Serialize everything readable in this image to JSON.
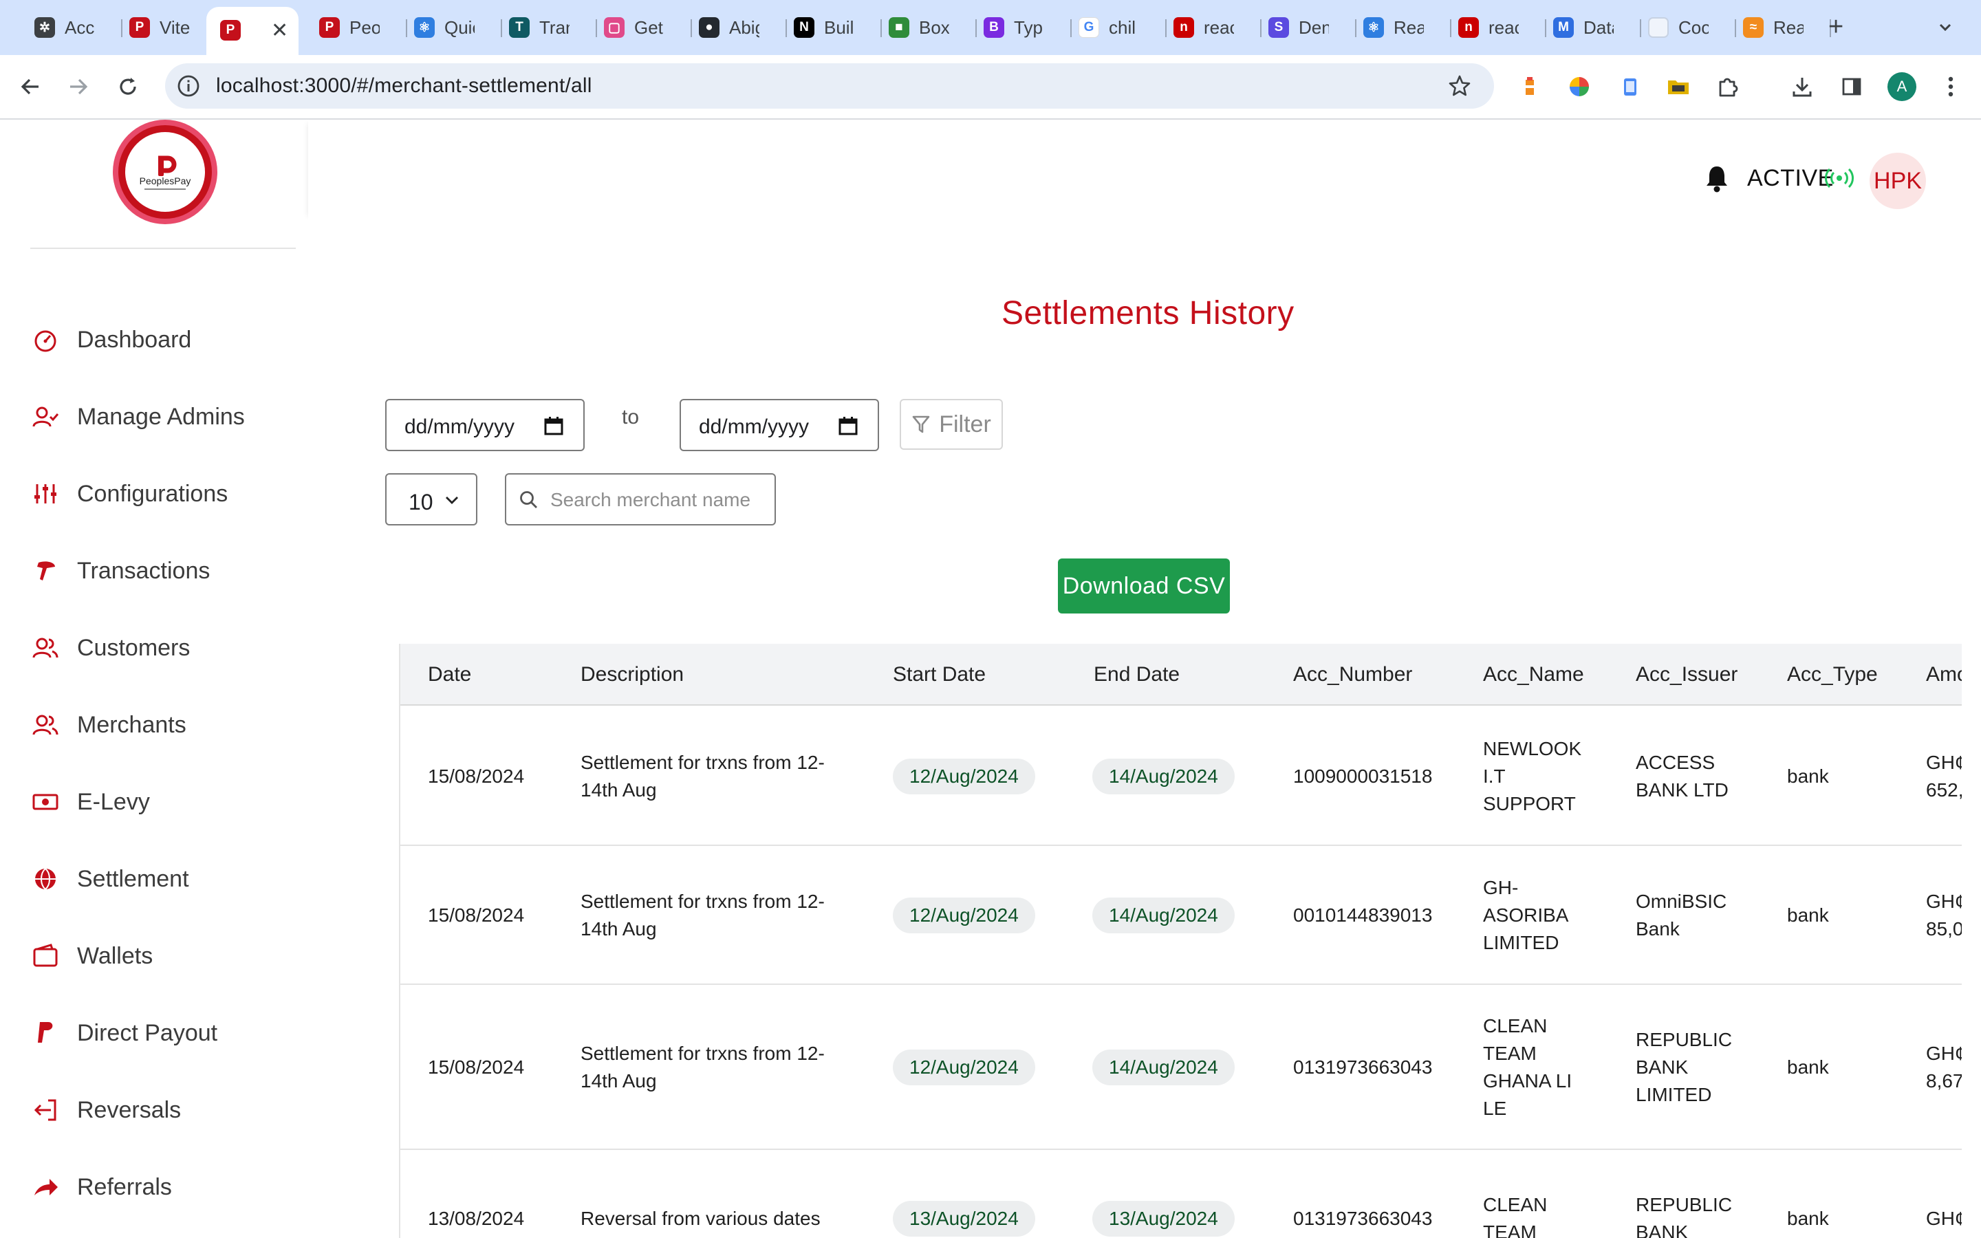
{
  "browser": {
    "tabs": [
      {
        "title": "Acc",
        "favicon": "openai-icon"
      },
      {
        "title": "Vite",
        "favicon": "peoplespay-icon"
      },
      {
        "title": "",
        "favicon": "peoplespay-icon",
        "active": true
      },
      {
        "title": "Peo",
        "favicon": "peoplespay-icon"
      },
      {
        "title": "Quic",
        "favicon": "react-icon"
      },
      {
        "title": "Tran",
        "favicon": "translate-icon"
      },
      {
        "title": "Get",
        "favicon": "app-icon"
      },
      {
        "title": "Abig",
        "favicon": "github-icon"
      },
      {
        "title": "Buil",
        "favicon": "nextjs-icon"
      },
      {
        "title": "Box",
        "favicon": "box-icon"
      },
      {
        "title": "Typ",
        "favicon": "bootstrap-icon"
      },
      {
        "title": "chil",
        "favicon": "google-icon"
      },
      {
        "title": "reac",
        "favicon": "npm-icon"
      },
      {
        "title": "Den",
        "favicon": "stitches-icon"
      },
      {
        "title": "Rea",
        "favicon": "react-icon"
      },
      {
        "title": "reac",
        "favicon": "npm-icon"
      },
      {
        "title": "Data",
        "favicon": "mui-icon"
      },
      {
        "title": "Coo",
        "favicon": "blank-page-icon"
      },
      {
        "title": "Rea",
        "favicon": "rainbow-icon"
      }
    ],
    "url": "localhost:3000/#/merchant-settlement/all",
    "profile_initial": "A"
  },
  "sidebar": {
    "logo_text": "PeoplesPay",
    "items": [
      {
        "label": "Dashboard",
        "icon": "dashboard-gauge-icon"
      },
      {
        "label": "Manage Admins",
        "icon": "user-check-icon"
      },
      {
        "label": "Configurations",
        "icon": "sliders-icon"
      },
      {
        "label": "Transactions",
        "icon": "transactions-icon"
      },
      {
        "label": "Customers",
        "icon": "users-icon"
      },
      {
        "label": "Merchants",
        "icon": "users-icon"
      },
      {
        "label": "E-Levy",
        "icon": "cash-icon"
      },
      {
        "label": "Settlement",
        "icon": "globe-icon"
      },
      {
        "label": "Wallets",
        "icon": "wallet-icon"
      },
      {
        "label": "Direct Payout",
        "icon": "paypal-icon"
      },
      {
        "label": "Reversals",
        "icon": "exit-icon"
      },
      {
        "label": "Referrals",
        "icon": "share-arrow-icon"
      }
    ]
  },
  "header": {
    "status": "ACTIVE",
    "avatar_initials": "HPK"
  },
  "page": {
    "title": "Settlements History",
    "date_from_placeholder": "dd/mm/yyyy",
    "to_label": "to",
    "date_to_placeholder": "dd/mm/yyyy",
    "filter_label": "Filter",
    "page_size": "10",
    "search_placeholder": "Search merchant name",
    "download_label": "Download CSV"
  },
  "table": {
    "columns": [
      "Date",
      "Description",
      "Start Date",
      "End Date",
      "Acc_Number",
      "Acc_Name",
      "Acc_Issuer",
      "Acc_Type",
      "Amo"
    ],
    "rows": [
      {
        "date": "15/08/2024",
        "description": [
          "Settlement for trxns from 12-",
          "14th Aug"
        ],
        "start": "12/Aug/2024",
        "end": "14/Aug/2024",
        "acc_number": "1009000031518",
        "acc_name": [
          "NEWLOOK",
          "I.T",
          "SUPPORT"
        ],
        "acc_issuer": [
          "ACCESS",
          "BANK LTD"
        ],
        "acc_type": "bank",
        "amount": [
          "GH¢",
          "652,"
        ]
      },
      {
        "date": "15/08/2024",
        "description": [
          "Settlement for trxns from 12-",
          "14th Aug"
        ],
        "start": "12/Aug/2024",
        "end": "14/Aug/2024",
        "acc_number": "0010144839013",
        "acc_name": [
          "GH-",
          "ASORIBA",
          "LIMITED"
        ],
        "acc_issuer": [
          "OmniBSIC",
          "Bank"
        ],
        "acc_type": "bank",
        "amount": [
          "GH¢",
          "85,0"
        ]
      },
      {
        "date": "15/08/2024",
        "description": [
          "Settlement for trxns from 12-",
          "14th Aug"
        ],
        "start": "12/Aug/2024",
        "end": "14/Aug/2024",
        "acc_number": "0131973663043",
        "acc_name": [
          "CLEAN",
          "TEAM",
          "GHANA LI",
          "LE"
        ],
        "acc_issuer": [
          "REPUBLIC",
          "BANK",
          "LIMITED"
        ],
        "acc_type": "bank",
        "amount": [
          "GH¢",
          "8,67"
        ]
      },
      {
        "date": "13/08/2024",
        "description": [
          "Reversal from various dates"
        ],
        "start": "13/Aug/2024",
        "end": "13/Aug/2024",
        "acc_number": "0131973663043",
        "acc_name": [
          "CLEAN",
          "TEAM"
        ],
        "acc_issuer": [
          "REPUBLIC",
          "BANK"
        ],
        "acc_type": "bank",
        "amount": [
          "GH¢"
        ]
      }
    ]
  },
  "colors": {
    "brand_red": "#c4101b",
    "csv_green": "#1e9b4c",
    "active_green": "#22c55e",
    "pill_text": "#0d5227",
    "tabbar": "#d3e3fd"
  }
}
